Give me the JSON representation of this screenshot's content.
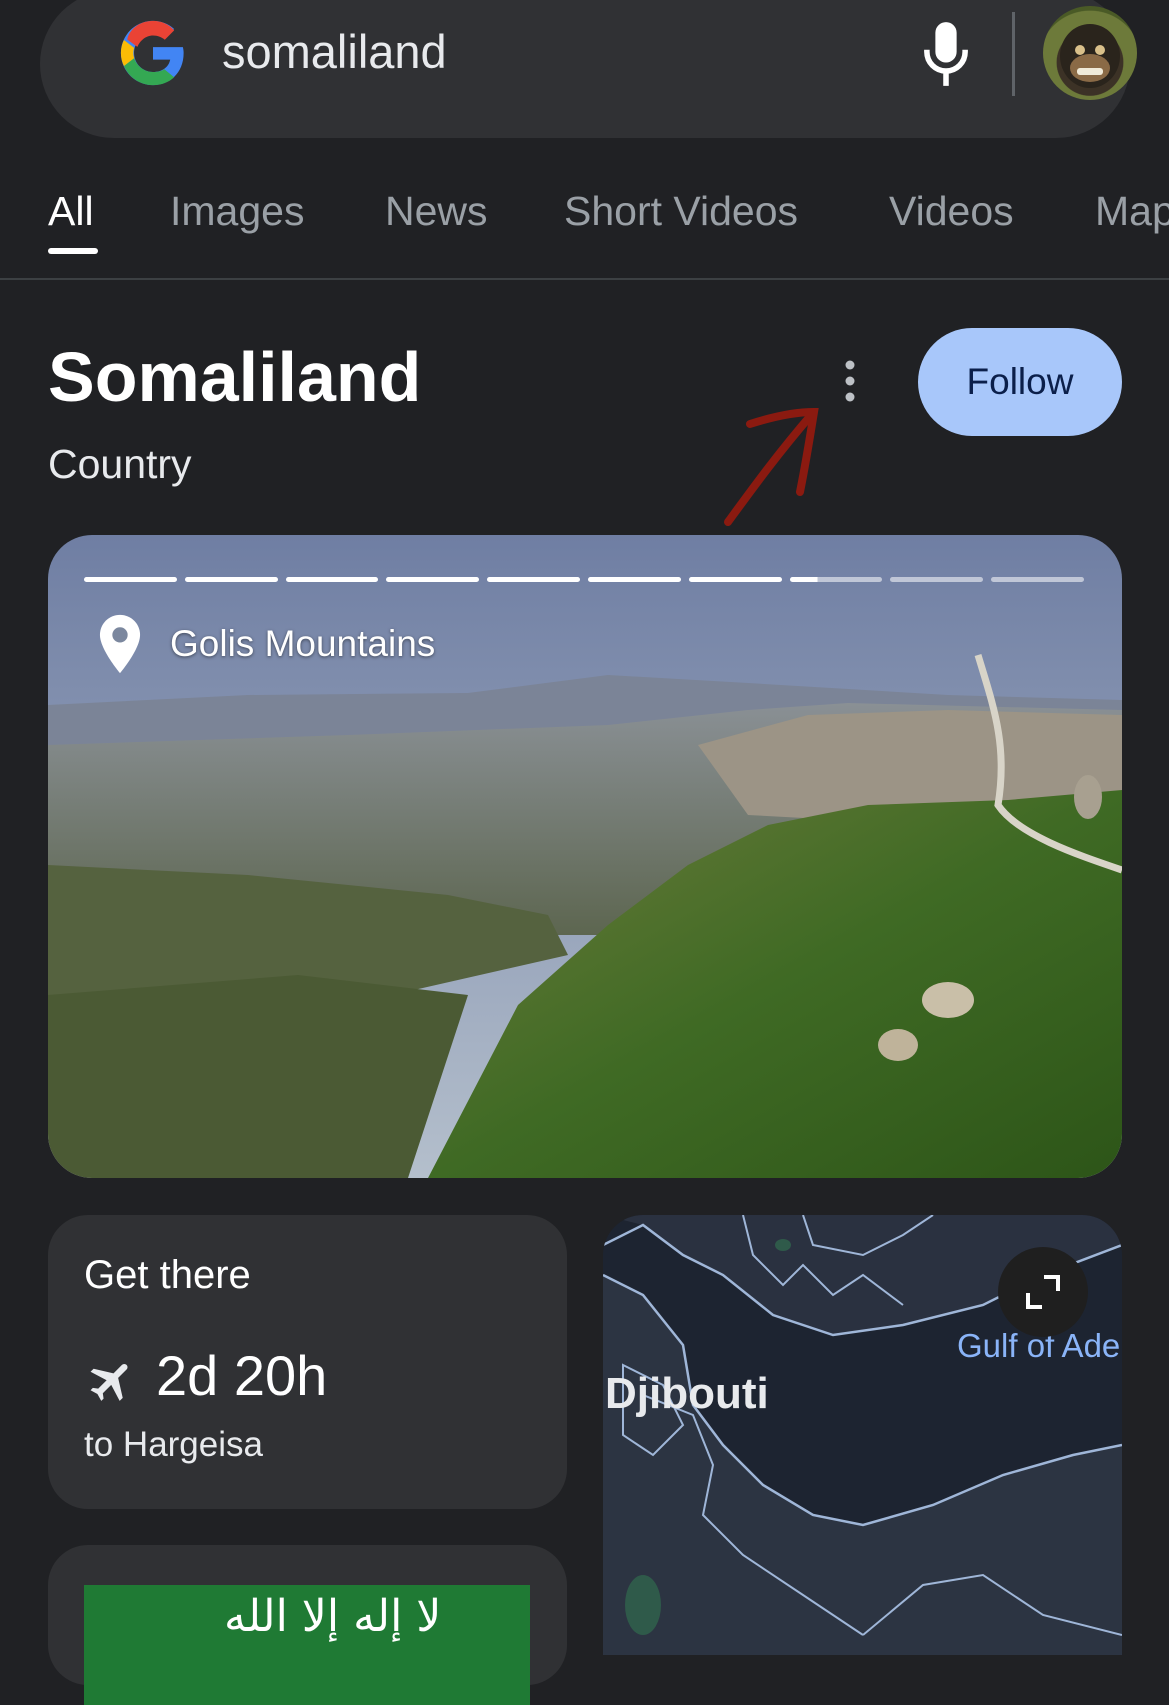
{
  "search": {
    "query": "somaliland"
  },
  "tabs": [
    "All",
    "Images",
    "News",
    "Short Videos",
    "Videos",
    "Maps"
  ],
  "panel": {
    "title": "Somaliland",
    "subtitle": "Country",
    "follow_label": "Follow"
  },
  "hero": {
    "place": "Golis Mountains",
    "slides_total": 10,
    "slides_viewed": 7.3
  },
  "get_there": {
    "title": "Get there",
    "duration": "2d 20h",
    "destination": "to Hargeisa"
  },
  "map": {
    "label_city": "Djibouti",
    "label_water": "Gulf of Ade"
  },
  "flag": {
    "script": "ﻻ إله إلا الله"
  },
  "colors": {
    "accent": "#a8c7fa",
    "background": "#202124",
    "card": "#303134",
    "annotation": "#8b1a10"
  }
}
